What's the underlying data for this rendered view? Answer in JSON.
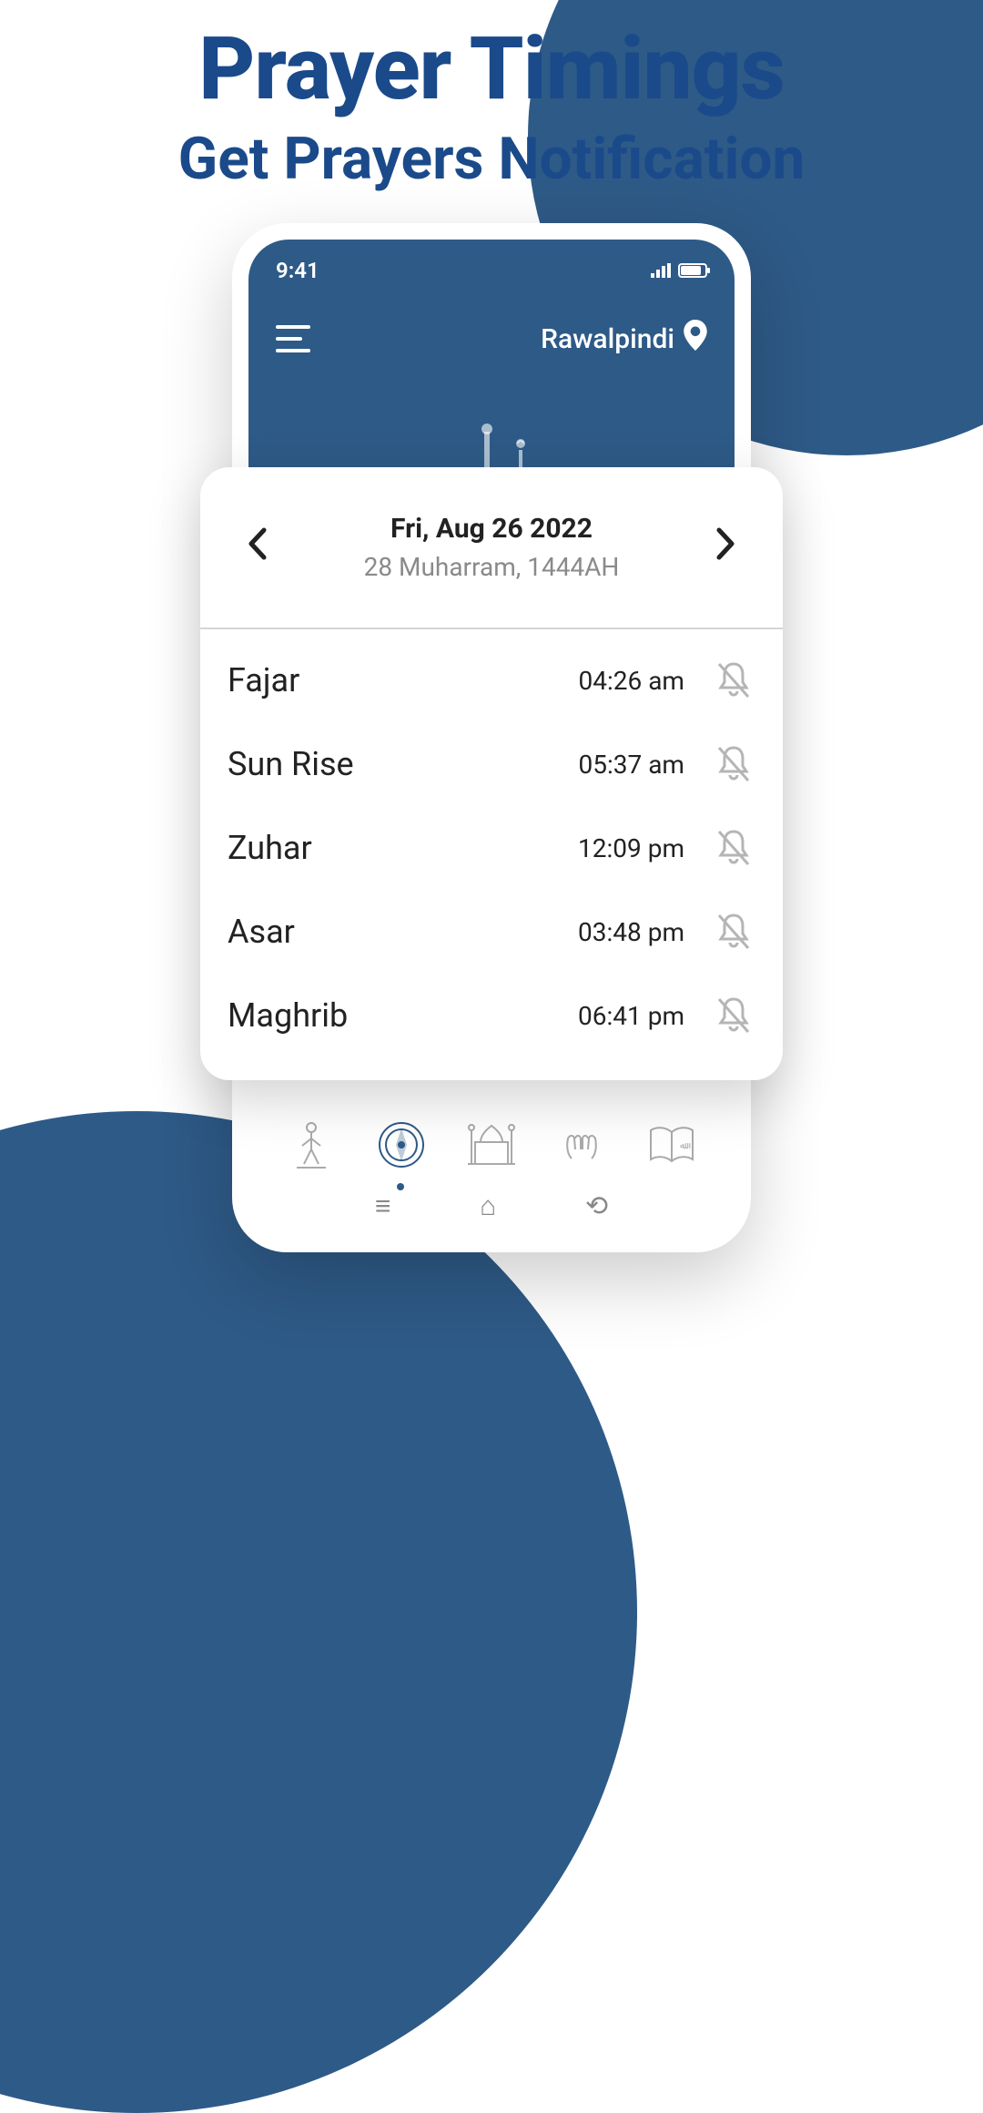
{
  "promo": {
    "title": "Prayer Timings",
    "subtitle": "Get Prayers Notification"
  },
  "status_bar": {
    "time": "9:41"
  },
  "topbar": {
    "location": "Rawalpindi"
  },
  "date": {
    "gregorian": "Fri, Aug 26 2022",
    "hijri": "28 Muharram, 1444AH"
  },
  "prayers": [
    {
      "name": "Fajar",
      "time": "04:26 am"
    },
    {
      "name": "Sun Rise",
      "time": "05:37 am"
    },
    {
      "name": "Zuhar",
      "time": "12:09 pm"
    },
    {
      "name": "Asar",
      "time": "03:48 pm"
    },
    {
      "name": "Maghrib",
      "time": "06:41 pm"
    }
  ]
}
